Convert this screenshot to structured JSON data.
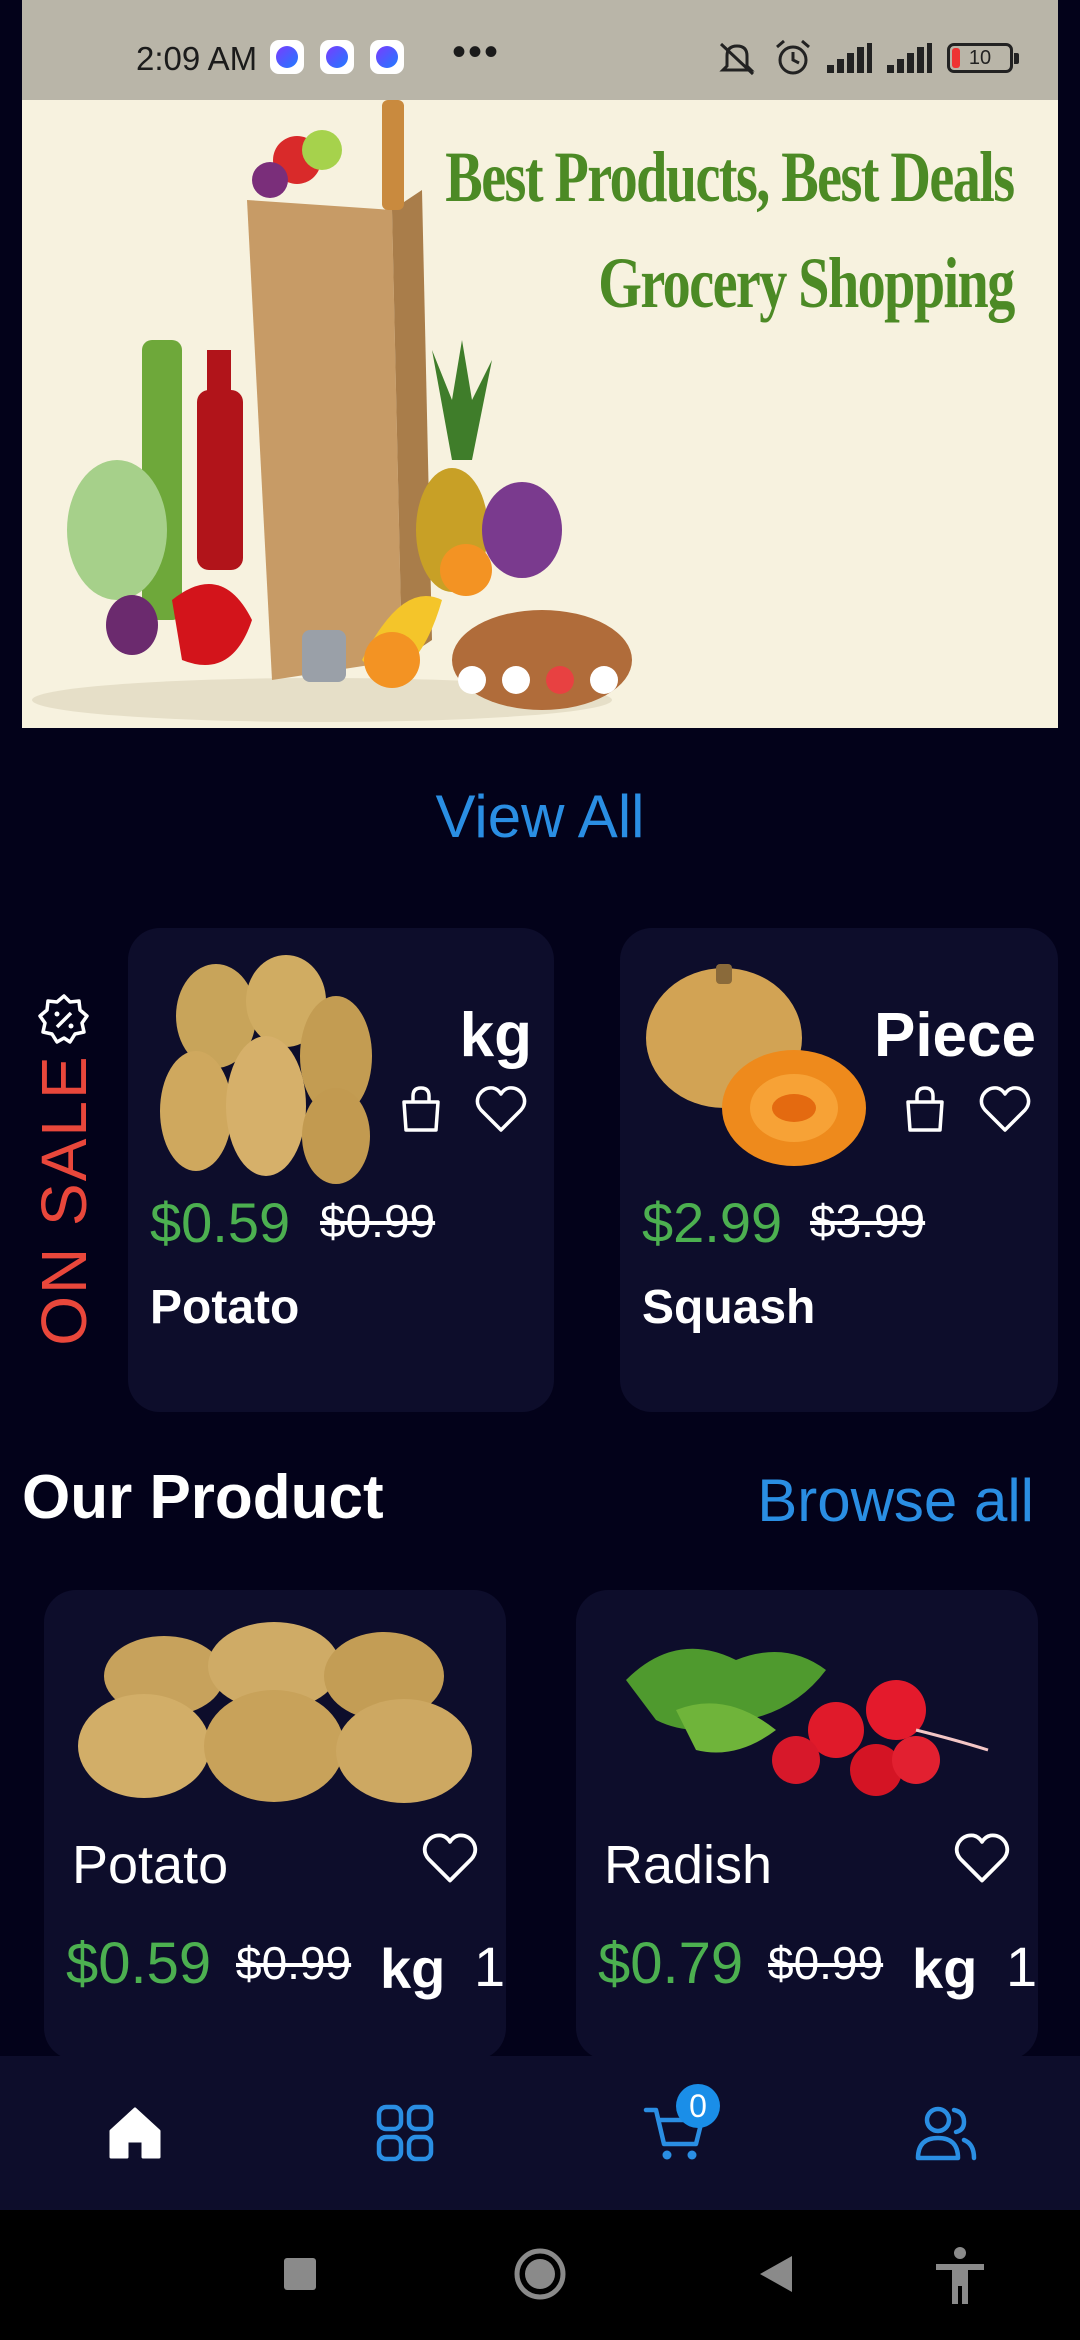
{
  "status_bar": {
    "time": "2:09 AM",
    "overflow": "•••",
    "battery": "10"
  },
  "banner": {
    "headline": "Best Products, Best Deals",
    "subheadline": "Grocery Shopping",
    "slide_count": 4,
    "active_slide": 3
  },
  "view_all_label": "View All",
  "on_sale": {
    "label": "ON SALE",
    "items": [
      {
        "name": "Potato",
        "unit": "kg",
        "price": "$0.59",
        "old_price": "$0.99"
      },
      {
        "name": "Squash",
        "unit": "Piece",
        "price": "$2.99",
        "old_price": "$3.99"
      }
    ]
  },
  "our_product": {
    "title": "Our Product",
    "browse_label": "Browse all",
    "items": [
      {
        "name": "Potato",
        "price": "$0.59",
        "old_price": "$0.99",
        "unit": "kg",
        "qty": "1"
      },
      {
        "name": "Radish",
        "price": "$0.79",
        "old_price": "$0.99",
        "unit": "kg",
        "qty": "1"
      }
    ]
  },
  "bottom_nav": {
    "items": [
      "home-icon",
      "grid-icon",
      "cart-icon",
      "users-icon"
    ],
    "cart_count": "0"
  },
  "colors": {
    "background": "#03021a",
    "card": "#0d0d2b",
    "accent": "#2a8ee3",
    "price": "#4cb050",
    "sale": "#e9473b"
  }
}
